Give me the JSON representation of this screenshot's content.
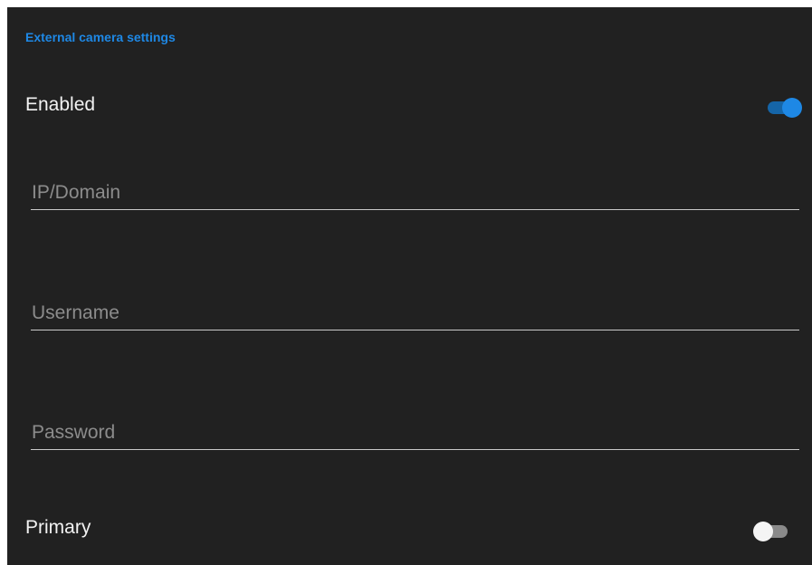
{
  "section": {
    "title": "External camera settings"
  },
  "enabled": {
    "label": "Enabled",
    "state": true
  },
  "fields": {
    "ip": {
      "placeholder": "IP/Domain",
      "value": ""
    },
    "username": {
      "placeholder": "Username",
      "value": ""
    },
    "password": {
      "placeholder": "Password",
      "value": ""
    }
  },
  "primary": {
    "label": "Primary",
    "state": false
  },
  "colors": {
    "accent": "#1e88e5",
    "background": "#212121",
    "text": "#f2f2f2",
    "placeholder": "#8c8c8c",
    "underline": "#c9c9c9"
  }
}
